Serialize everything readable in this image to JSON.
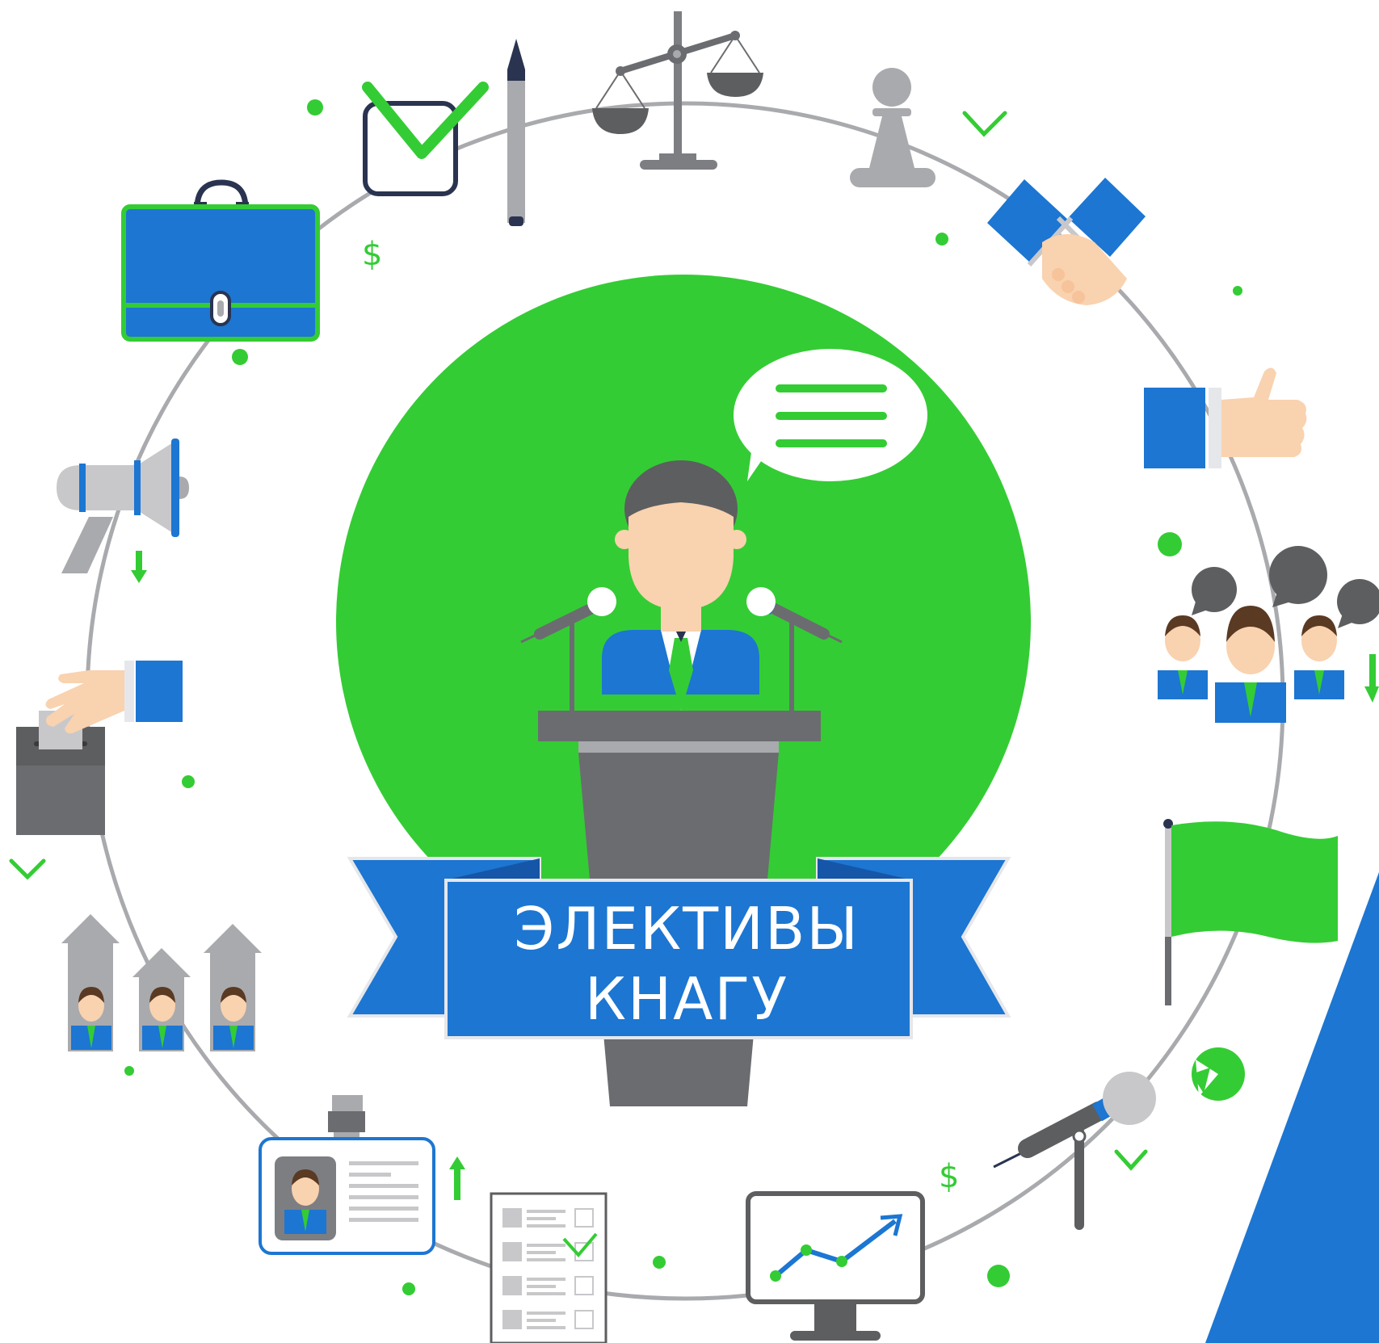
{
  "banner": {
    "line1": "ЭЛЕКТИВЫ",
    "line2": "КНАГУ"
  },
  "decor": {
    "dollar_symbol": "$"
  },
  "colors": {
    "green": "#34CC34",
    "blue": "#1C76D2",
    "gray_dark": "#6B6C70",
    "gray_mid": "#A9AAAD",
    "gray_light": "#C8C8CB",
    "skin": "#F9D2AF",
    "hair": "#5D5E60",
    "hair_brown": "#5A3A22",
    "navy_outline": "#2A3450"
  },
  "icons": [
    "check-box-icon",
    "pen-icon",
    "scales-icon",
    "pawn-icon",
    "handshake-icon",
    "thumbs-up-icon",
    "crowd-speech-icon",
    "flag-icon",
    "pie-chart-icon",
    "microphone-icon",
    "monitor-chart-icon",
    "checklist-icon",
    "id-badge-icon",
    "candidates-up-icon",
    "ballot-box-icon",
    "megaphone-icon",
    "briefcase-icon"
  ]
}
